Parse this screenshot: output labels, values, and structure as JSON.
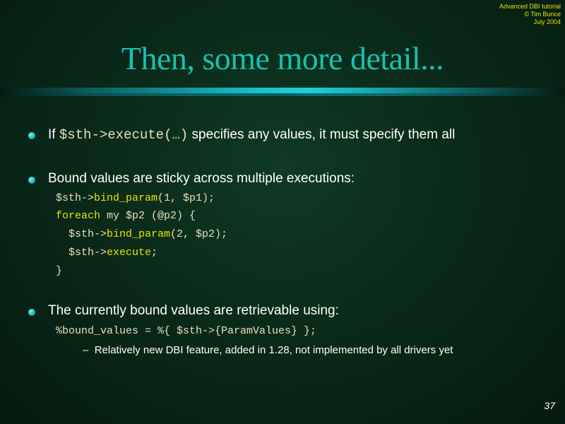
{
  "corner": {
    "line1": "Advanced DBI tutorial",
    "line2": "© Tim Bunce",
    "line3": "July 2004"
  },
  "title": "Then, some more detail...",
  "bullets": [
    {
      "pre": "If ",
      "code": "$sth->execute(…)",
      "post": " specifies any values, it must specify them all"
    },
    {
      "text": "Bound values are sticky across multiple executions:"
    },
    {
      "text": "The currently bound values are retrievable using:"
    }
  ],
  "code_block": {
    "l1_a": "$sth->",
    "l1_b": "bind_param",
    "l1_c": "(1, $p1);",
    "l2_a": "foreach",
    "l2_b": " my $p2 (@p2) {",
    "l3_a": "  $sth->",
    "l3_b": "bind_param",
    "l3_c": "(2, $p2);",
    "l4_a": "  $sth->",
    "l4_b": "execute",
    "l4_c": ";",
    "l5": "}"
  },
  "code_line2": "%bound_values = %{ $sth->{ParamValues} };",
  "sub_bullet": {
    "dash": "–",
    "text": "Relatively new DBI feature, added in 1.28, not implemented by all drivers yet"
  },
  "page_number": "37",
  "colors": {
    "title": "#16c2b0",
    "corner_text": "#e6e600",
    "bullet": "#18b8b0",
    "code": "#e8e0b8",
    "keyword": "#e6e600",
    "background": "#0a2a1a"
  }
}
